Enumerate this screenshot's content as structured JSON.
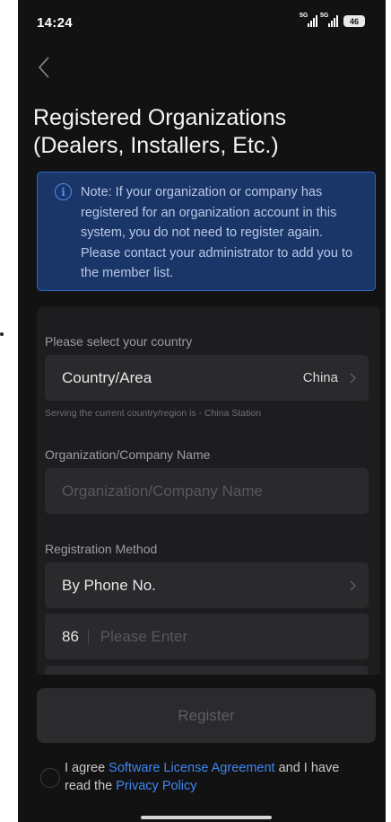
{
  "status_bar": {
    "time": "14:24",
    "signal1_tag": "5G",
    "signal2_tag": "5G",
    "battery": "46"
  },
  "page": {
    "title_line1": "Registered Organizations",
    "title_line2": "(Dealers, Installers, Etc.)"
  },
  "note": {
    "icon": "info-icon",
    "text": "Note: If your organization or company has registered for an organization account in this system, you do not need to register again. Please contact your administrator to add you to the member list."
  },
  "form": {
    "country_label": "Please select your country",
    "country_row_label": "Country/Area",
    "country_value": "China",
    "station_hint": "Serving the current country/region is - China Station",
    "org_label": "Organization/Company Name",
    "org_placeholder": "Organization/Company Name",
    "method_label": "Registration Method",
    "method_value": "By Phone No.",
    "phone_code": "86",
    "phone_placeholder": "Please Enter"
  },
  "register_button": "Register",
  "agreement": {
    "prefix": "I agree ",
    "license_link": "Software License Agreement",
    "middle": " and I have read the ",
    "privacy_link": "Privacy Policy"
  },
  "colors": {
    "background": "#121213",
    "accent_blue": "#3f86f0",
    "note_bg": "#1a3669"
  }
}
